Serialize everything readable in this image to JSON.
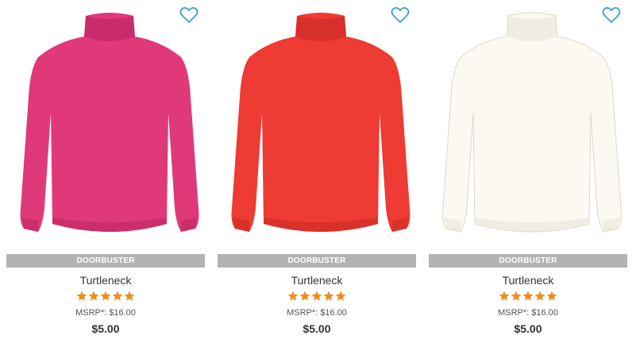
{
  "products": [
    {
      "color_name": "pink",
      "color": "#e0397a",
      "shade": "#b8235e",
      "badge": "DOORBUSTER",
      "name": "Turtleneck",
      "rating": 5,
      "msrp": "MSRP*: $16.00",
      "price": "$5.00",
      "favorite_icon": "heart-outline-icon"
    },
    {
      "color_name": "red",
      "color": "#ee3b33",
      "shade": "#c42620",
      "badge": "DOORBUSTER",
      "name": "Turtleneck",
      "rating": 5,
      "msrp": "MSRP*: $16.00",
      "price": "$5.00",
      "favorite_icon": "heart-outline-icon"
    },
    {
      "color_name": "white",
      "color": "#fbf9f2",
      "shade": "#e6e2d6",
      "badge": "DOORBUSTER",
      "name": "Turtleneck",
      "rating": 5,
      "msrp": "MSRP*: $16.00",
      "price": "$5.00",
      "favorite_icon": "heart-outline-icon"
    }
  ],
  "theme": {
    "heart_color": "#3b9fd6",
    "star_color": "#f08c1e",
    "badge_bg": "#b3b3b3"
  }
}
